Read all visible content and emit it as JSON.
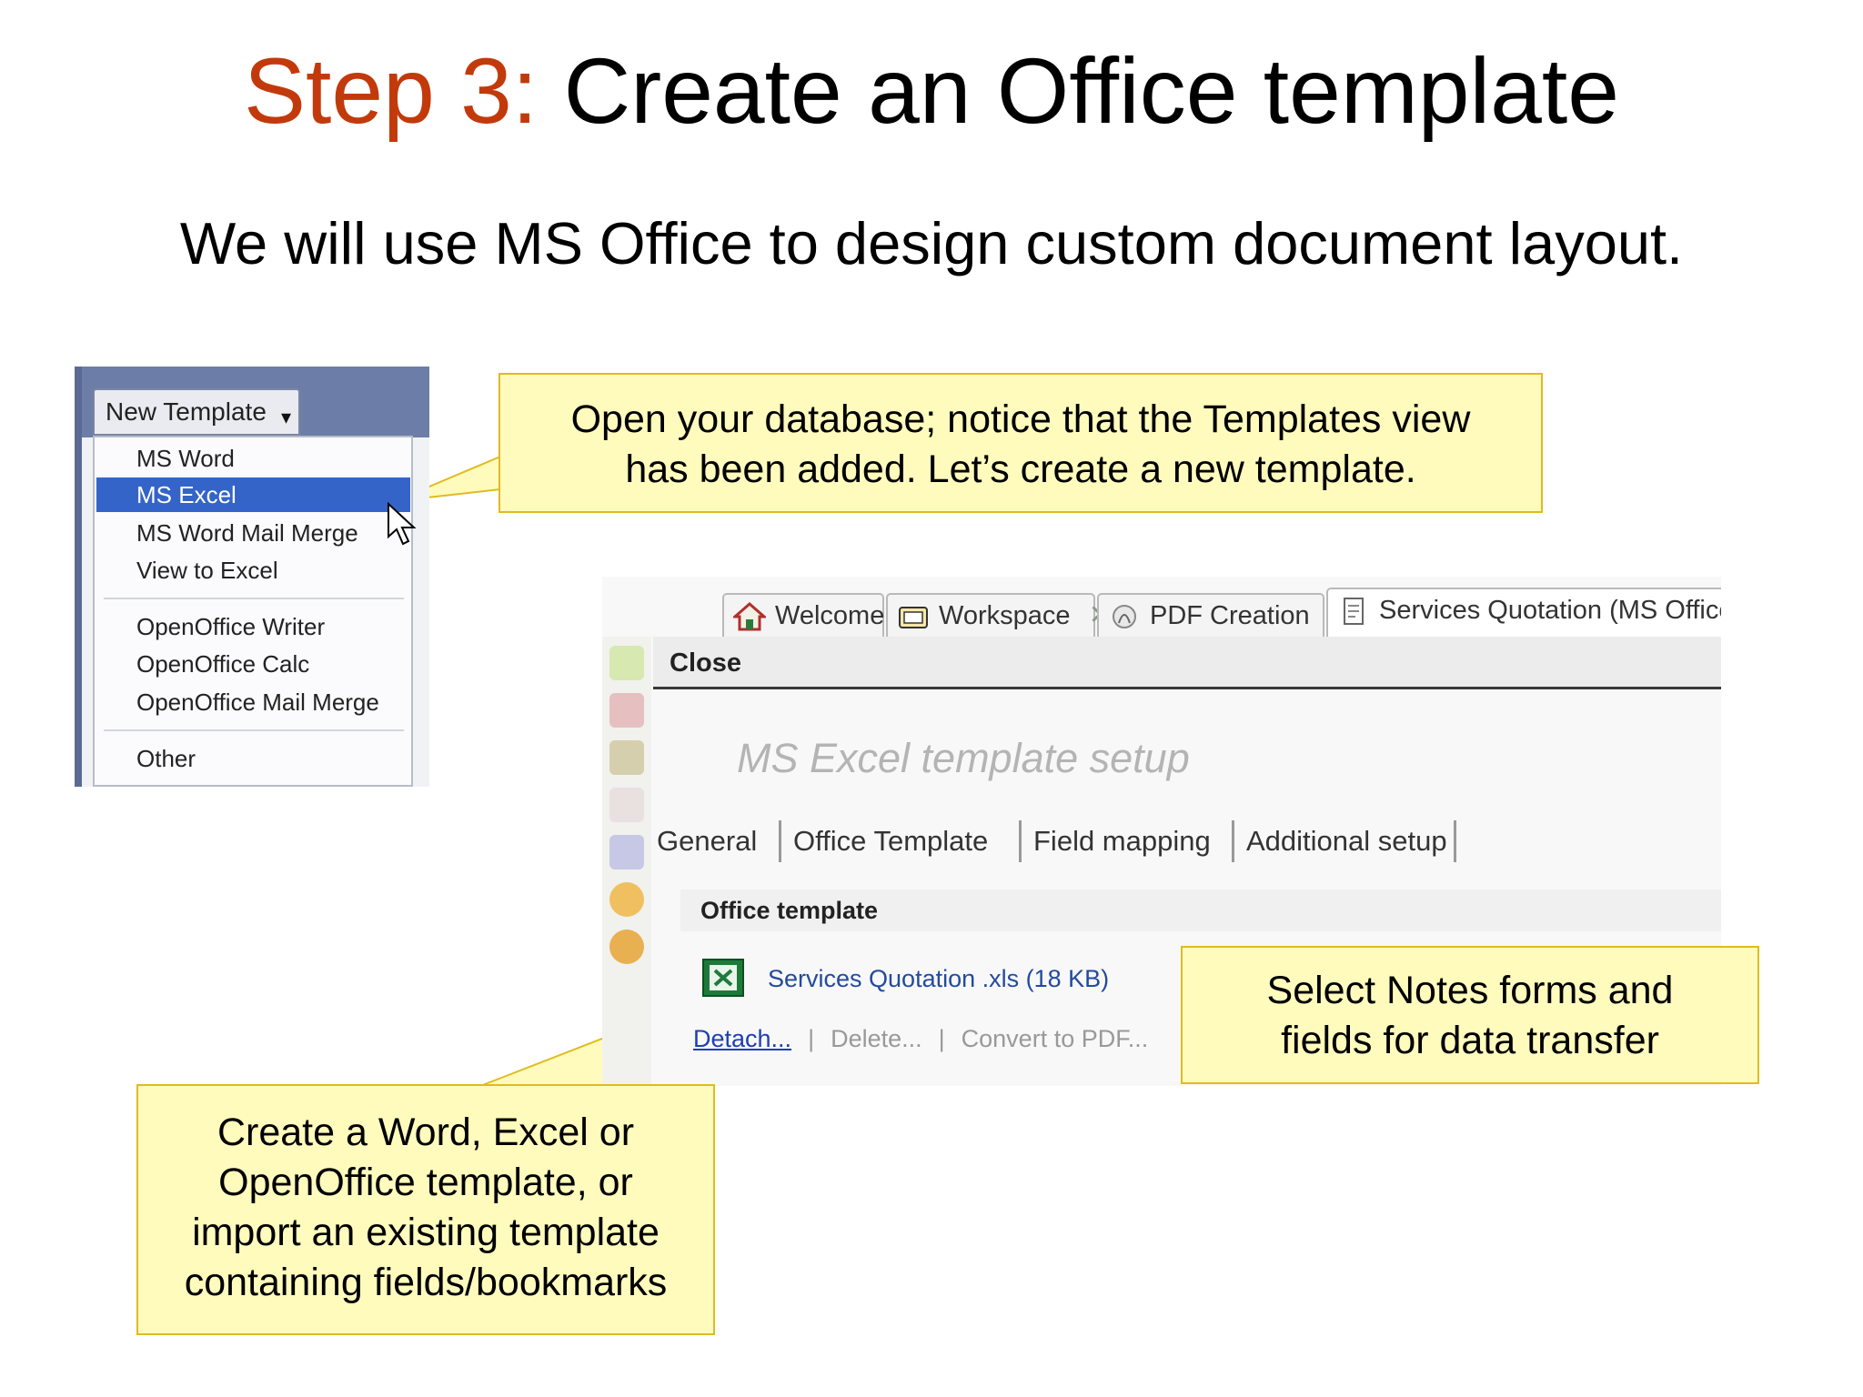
{
  "slide": {
    "title_step": "Step 3:",
    "title_rest": "Create an Office template",
    "subtitle": "We will use MS Office to design custom document layout."
  },
  "template_menu": {
    "button_label": "New Template",
    "items": [
      "MS Word",
      "MS Excel",
      "MS Word Mail Merge",
      "View to Excel",
      "OpenOffice Writer",
      "OpenOffice Calc",
      "OpenOffice Mail Merge",
      "Other"
    ],
    "selected": "MS Excel"
  },
  "callouts": {
    "top": [
      "Open your database; notice that the Templates view",
      "has been added. Let’s create a new template."
    ],
    "right": [
      "Select Notes forms and",
      "fields for data transfer"
    ],
    "bottom": [
      "Create a Word, Excel or",
      "OpenOffice template, or",
      "import an existing template",
      "containing fields/bookmarks"
    ]
  },
  "app": {
    "tabs": [
      {
        "label": "Welcome",
        "icon": "home-icon",
        "closable": false
      },
      {
        "label": "Workspace",
        "icon": "workspace-icon",
        "closable": true
      },
      {
        "label": "PDF Creation",
        "icon": "pdf-creation-icon",
        "closable": true
      },
      {
        "label": "Services Quotation (MS Office)",
        "icon": "document-icon",
        "closable": true
      }
    ],
    "close_label": "Close",
    "form_title": "MS Excel template setup",
    "subtabs": [
      "General",
      "Office Template",
      "Field mapping",
      "Additional setup"
    ],
    "section_title": "Office template",
    "file_name": "Services Quotation .xls (18 KB)",
    "actions": {
      "detach": "Detach...",
      "delete": "Delete...",
      "convert": "Convert to PDF..."
    },
    "close_glyph": "✕",
    "dropdown_glyph": "▾"
  },
  "colors": {
    "step_accent": "#c23a0c",
    "callout_fill": "#fffbbd",
    "callout_border": "#e0bb20",
    "menu_selection": "#3464c8"
  }
}
